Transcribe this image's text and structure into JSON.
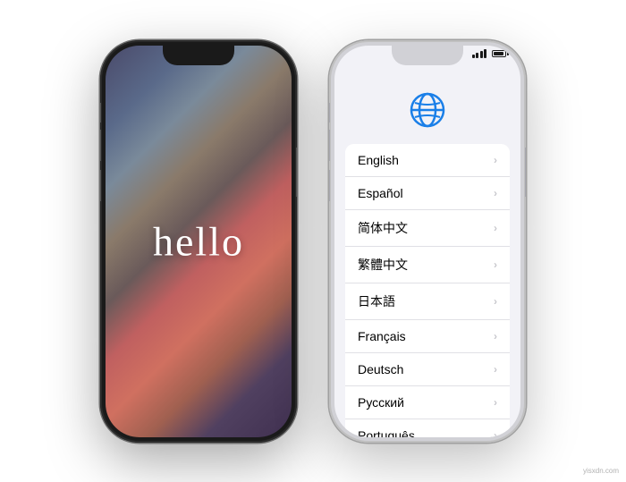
{
  "background_color": "#ffffff",
  "left_phone": {
    "hello_text": "hello",
    "screen_type": "hello"
  },
  "right_phone": {
    "screen_type": "language_selection",
    "globe_icon": "globe-icon",
    "languages": [
      {
        "name": "English"
      },
      {
        "name": "Español"
      },
      {
        "name": "简体中文"
      },
      {
        "name": "繁體中文"
      },
      {
        "name": "日本語"
      },
      {
        "name": "Français"
      },
      {
        "name": "Deutsch"
      },
      {
        "name": "Русский"
      },
      {
        "name": "Português"
      }
    ]
  },
  "watermark": {
    "text": "yisxdn.com"
  }
}
